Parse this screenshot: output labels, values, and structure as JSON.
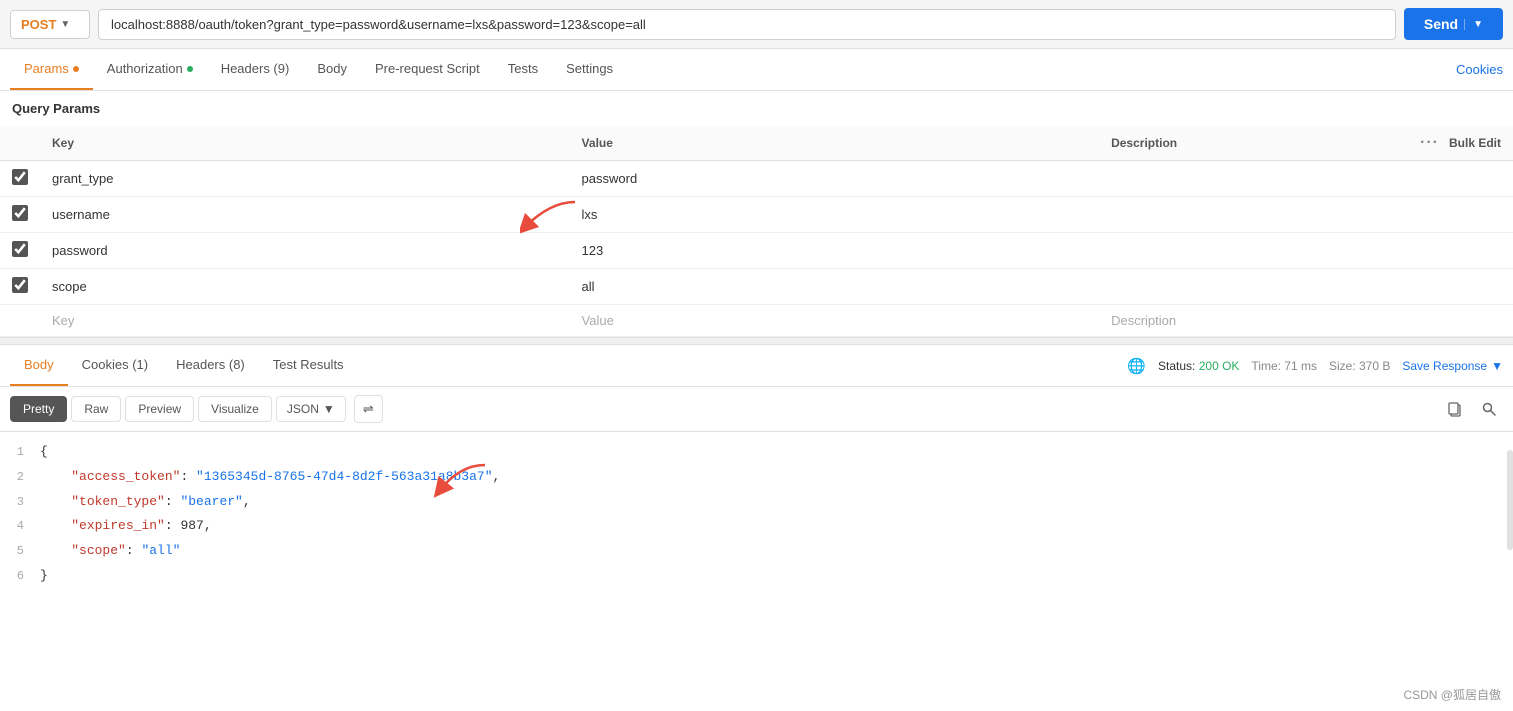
{
  "urlBar": {
    "method": "POST",
    "url": "localhost:8888/oauth/token?grant_type=password&username=lxs&password=123&scope=all",
    "sendLabel": "Send"
  },
  "requestTabs": {
    "items": [
      {
        "label": "Params",
        "dot": "orange",
        "active": true
      },
      {
        "label": "Authorization",
        "dot": "green",
        "active": false
      },
      {
        "label": "Headers (9)",
        "dot": null,
        "active": false
      },
      {
        "label": "Body",
        "dot": null,
        "active": false
      },
      {
        "label": "Pre-request Script",
        "dot": null,
        "active": false
      },
      {
        "label": "Tests",
        "dot": null,
        "active": false
      },
      {
        "label": "Settings",
        "dot": null,
        "active": false
      }
    ],
    "cookiesLabel": "Cookies"
  },
  "queryParams": {
    "sectionLabel": "Query Params",
    "columns": {
      "key": "Key",
      "value": "Value",
      "description": "Description",
      "bulkEdit": "Bulk Edit"
    },
    "rows": [
      {
        "checked": true,
        "key": "grant_type",
        "value": "password",
        "description": ""
      },
      {
        "checked": true,
        "key": "username",
        "value": "lxs",
        "description": ""
      },
      {
        "checked": true,
        "key": "password",
        "value": "123",
        "description": ""
      },
      {
        "checked": true,
        "key": "scope",
        "value": "all",
        "description": ""
      }
    ],
    "emptyRow": {
      "keyPlaceholder": "Key",
      "valuePlaceholder": "Value",
      "descPlaceholder": "Description"
    }
  },
  "responseTabs": {
    "items": [
      {
        "label": "Body",
        "active": true
      },
      {
        "label": "Cookies (1)",
        "active": false
      },
      {
        "label": "Headers (8)",
        "active": false
      },
      {
        "label": "Test Results",
        "active": false
      }
    ],
    "status": "Status:",
    "statusCode": "200 OK",
    "time": "Time: 71 ms",
    "size": "Size: 370 B",
    "saveResponse": "Save Response"
  },
  "formatTabs": {
    "items": [
      {
        "label": "Pretty",
        "active": true
      },
      {
        "label": "Raw",
        "active": false
      },
      {
        "label": "Preview",
        "active": false
      },
      {
        "label": "Visualize",
        "active": false
      }
    ],
    "jsonLabel": "JSON"
  },
  "jsonResponse": {
    "lines": [
      {
        "num": 1,
        "content": "{"
      },
      {
        "num": 2,
        "content": "    \"access_token\": \"1365345d-8765-47d4-8d2f-563a31a8b3a7\","
      },
      {
        "num": 3,
        "content": "    \"token_type\": \"bearer\","
      },
      {
        "num": 4,
        "content": "    \"expires_in\": 987,"
      },
      {
        "num": 5,
        "content": "    \"scope\": \"all\""
      },
      {
        "num": 6,
        "content": "}"
      }
    ]
  },
  "watermark": "CSDN @狐居自傲"
}
